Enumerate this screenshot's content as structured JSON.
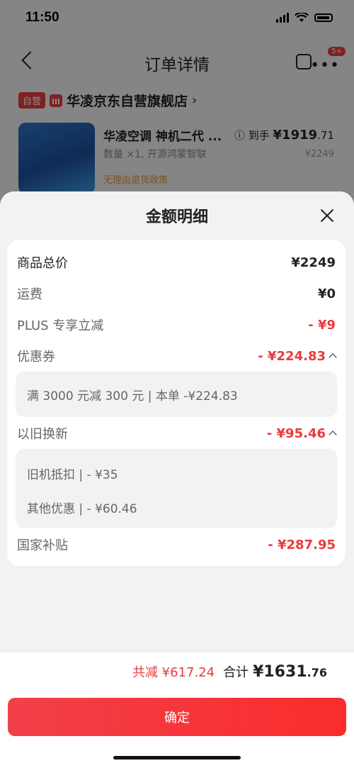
{
  "status_bar": {
    "time": "11:50"
  },
  "nav": {
    "title": "订单详情",
    "badge": "5+"
  },
  "shop": {
    "tag": "自营",
    "name": "华凌京东自营旗舰店",
    "chevron": "›"
  },
  "product": {
    "name": "华凌空调 神机二代 ...",
    "quantity": "数量 ×1, 开源鸿蒙智联",
    "policy": "无理由退货政策",
    "final_label": "到手",
    "final_price_int": "¥1919",
    "final_price_dec": ".71",
    "original_price": "¥2249"
  },
  "sheet": {
    "title": "金额明细",
    "rows": {
      "subtotal": {
        "label": "商品总价",
        "value": "¥2249"
      },
      "shipping": {
        "label": "运费",
        "value": "¥0"
      },
      "plus": {
        "label": "PLUS 专享立减",
        "value": "- ¥9"
      },
      "coupon": {
        "label": "优惠券",
        "value": "- ¥224.83"
      },
      "coupon_detail": "满 3000 元减 300 元 | 本单 -¥224.83",
      "tradein": {
        "label": "以旧换新",
        "value": "- ¥95.46"
      },
      "tradein_details": [
        "旧机抵扣 | - ¥35",
        "其他优惠 | - ¥60.46"
      ],
      "subsidy": {
        "label": "国家补贴",
        "value": "- ¥287.95"
      }
    }
  },
  "footer": {
    "saved": "共减 ¥617.24",
    "total_label": "合计",
    "total_int": "¥1631",
    "total_dec": ".76",
    "confirm_label": "确定"
  },
  "colors": {
    "accent_red": "#e93b3d",
    "policy_orange": "#e69138"
  }
}
